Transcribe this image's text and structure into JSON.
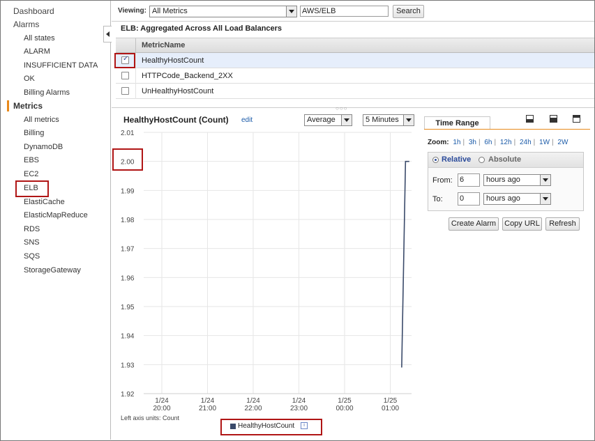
{
  "sidebar": {
    "items": [
      {
        "label": "Dashboard"
      },
      {
        "label": "Alarms"
      },
      {
        "label": "All states"
      },
      {
        "label": "ALARM"
      },
      {
        "label": "INSUFFICIENT DATA"
      },
      {
        "label": "OK"
      },
      {
        "label": "Billing Alarms"
      },
      {
        "label": "Metrics"
      },
      {
        "label": "All metrics"
      },
      {
        "label": "Billing"
      },
      {
        "label": "DynamoDB"
      },
      {
        "label": "EBS"
      },
      {
        "label": "EC2"
      },
      {
        "label": "ELB"
      },
      {
        "label": "ElastiCache"
      },
      {
        "label": "ElasticMapReduce"
      },
      {
        "label": "RDS"
      },
      {
        "label": "SNS"
      },
      {
        "label": "SQS"
      },
      {
        "label": "StorageGateway"
      }
    ]
  },
  "toolbar": {
    "viewing_label": "Viewing:",
    "viewing_value": "All Metrics",
    "search_value": "AWS/ELB",
    "search_button": "Search"
  },
  "metrics": {
    "section_title": "ELB: Aggregated Across All Load Balancers",
    "column_header": "MetricName",
    "rows": [
      {
        "name": "HealthyHostCount",
        "checked": true
      },
      {
        "name": "HTTPCode_Backend_2XX",
        "checked": false
      },
      {
        "name": "UnHealthyHostCount",
        "checked": false
      }
    ]
  },
  "chart": {
    "title": "HealthyHostCount (Count)",
    "edit_label": "edit",
    "statistic": "Average",
    "period": "5 Minutes",
    "axis_units_label": "Left axis units: Count",
    "line_color": "#3a4a6a"
  },
  "chart_data": {
    "type": "line",
    "title": "HealthyHostCount (Count)",
    "xlabel": "",
    "ylabel": "",
    "ylim": [
      1.92,
      2.01
    ],
    "y_ticks": [
      "2.01",
      "2.00",
      "1.99",
      "1.98",
      "1.97",
      "1.96",
      "1.95",
      "1.94",
      "1.93",
      "1.92"
    ],
    "x_ticks": [
      {
        "date": "1/24",
        "time": "20:00"
      },
      {
        "date": "1/24",
        "time": "21:00"
      },
      {
        "date": "1/24",
        "time": "22:00"
      },
      {
        "date": "1/24",
        "time": "23:00"
      },
      {
        "date": "1/25",
        "time": "00:00"
      },
      {
        "date": "1/25",
        "time": "01:00"
      }
    ],
    "series": [
      {
        "name": "HealthyHostCount",
        "points": [
          {
            "x": "1/25 01:15",
            "y": 1.929
          },
          {
            "x": "1/25 01:20",
            "y": 2.0
          },
          {
            "x": "1/25 01:25",
            "y": 2.0
          }
        ]
      }
    ]
  },
  "time_range": {
    "tab_label": "Time Range",
    "zoom_label": "Zoom:",
    "zoom_options": [
      "1h",
      "3h",
      "6h",
      "12h",
      "24h",
      "1W",
      "2W"
    ],
    "relative_label": "Relative",
    "absolute_label": "Absolute",
    "from_label": "From:",
    "from_value": "6",
    "from_unit": "hours ago",
    "to_label": "To:",
    "to_value": "0",
    "to_unit": "hours ago",
    "buttons": [
      "Create Alarm",
      "Copy URL",
      "Refresh"
    ]
  },
  "colors": {
    "highlight": "#b01515",
    "accent": "#e8891a",
    "link": "#1a5aa8"
  }
}
